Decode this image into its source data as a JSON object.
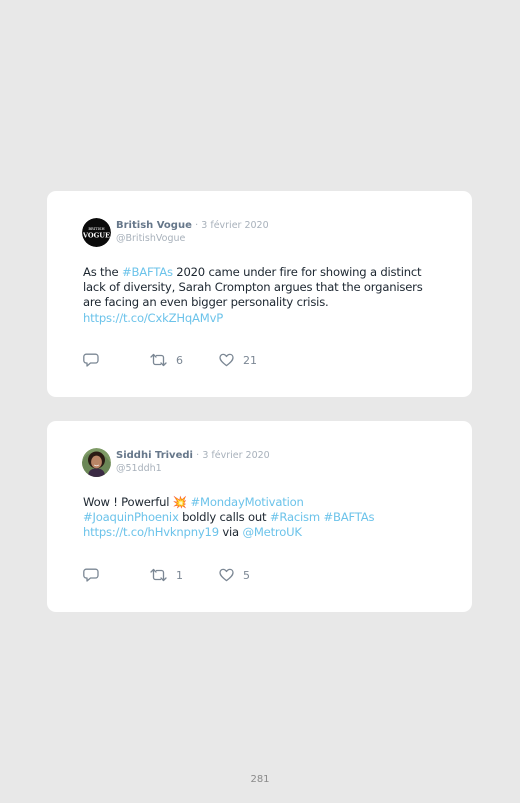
{
  "tweets": [
    {
      "author": "British Vogue",
      "separator": "·",
      "date": "3 février 2020",
      "handle": "@BritishVogue",
      "avatar_text": "BRITISH VOGUE",
      "text": {
        "p1": "As the ",
        "hashtag": "#BAFTAs",
        "p2": " 2020 came under fire for showing a distinct lack of diversity, Sarah Crompton argues that the organisers are facing an even bigger personality crisis. ",
        "link": "https://t.co/CxkZHqAMvP"
      },
      "retweets": "6",
      "likes": "21"
    },
    {
      "author": "Siddhi Trivedi",
      "separator": "·",
      "date": "3 février 2020",
      "handle": "@51ddh1",
      "text": {
        "p1": "Wow ! Powerful ",
        "emoji": "💥",
        "h1": "#MondayMotivation",
        "h2": "#JoaquinPhoenix",
        "p2": " boldly calls out ",
        "h3": "#Racism",
        "h4": "#BAFTAs",
        "link": "https://t.co/hHvknpny19",
        "p3": " via ",
        "mention": "@MetroUK"
      },
      "retweets": "1",
      "likes": "5"
    }
  ],
  "page_number": "281",
  "colors": {
    "background": "#e8e8e8",
    "card": "#ffffff",
    "link": "#6cc3ea",
    "author": "#66778a",
    "meta": "#a8b1bb",
    "icon": "#7b8794"
  },
  "icons": [
    "reply-icon",
    "retweet-icon",
    "like-icon"
  ]
}
